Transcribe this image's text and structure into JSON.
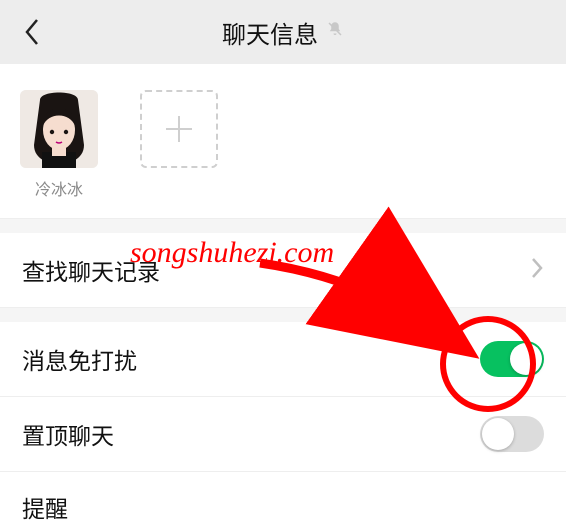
{
  "header": {
    "title": "聊天信息",
    "muted": true
  },
  "members": [
    {
      "name": "冷冰冰"
    }
  ],
  "rows": {
    "search_history": {
      "label": "查找聊天记录"
    },
    "mute": {
      "label": "消息免打扰",
      "on": true
    },
    "pin": {
      "label": "置顶聊天",
      "on": false
    },
    "remind": {
      "label": "提醒"
    }
  },
  "annotation": {
    "watermark": "songshuhezi.com"
  },
  "colors": {
    "accent": "#07c160",
    "annotation": "#ff0000"
  }
}
